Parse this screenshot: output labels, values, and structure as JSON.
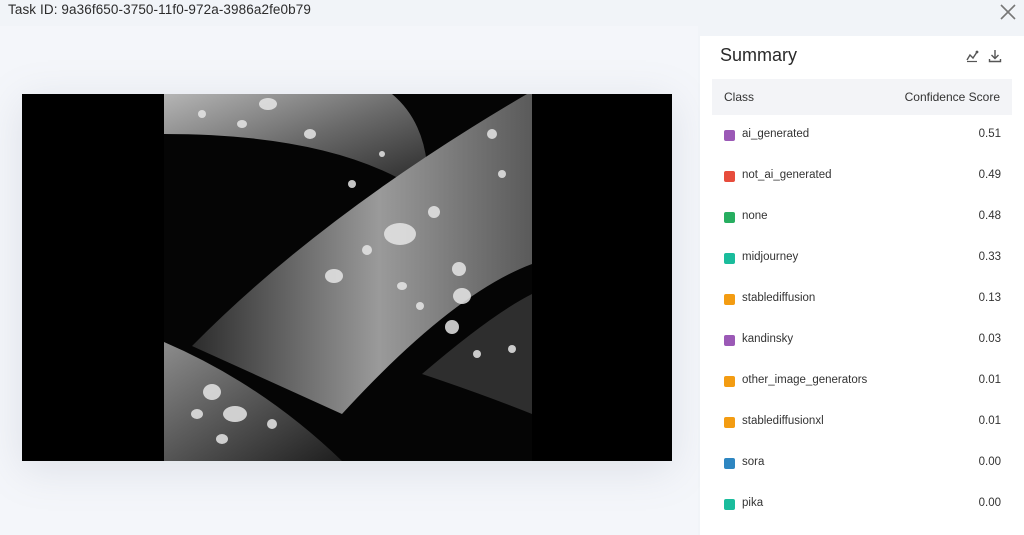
{
  "header": {
    "task_id_text": "Task ID: 9a36f650-3750-11f0-972a-3986a2fe0b79",
    "close_icon": "close-icon"
  },
  "image": {
    "icon": "image-preview",
    "colors": {
      "background": "#000000",
      "leaf": "#8a8a8a"
    }
  },
  "summary": {
    "title": "Summary",
    "icons": [
      "chart-icon",
      "download-icon"
    ],
    "columns": {
      "class": "Class",
      "score": "Confidence Score"
    },
    "rows": [
      {
        "label": "ai_generated",
        "score": "0.51",
        "color": "#9b59b6"
      },
      {
        "label": "not_ai_generated",
        "score": "0.49",
        "color": "#e74c3c"
      },
      {
        "label": "none",
        "score": "0.48",
        "color": "#27ae60"
      },
      {
        "label": "midjourney",
        "score": "0.33",
        "color": "#1abc9c"
      },
      {
        "label": "stablediffusion",
        "score": "0.13",
        "color": "#f39c12"
      },
      {
        "label": "kandinsky",
        "score": "0.03",
        "color": "#9b59b6"
      },
      {
        "label": "other_image_generators",
        "score": "0.01",
        "color": "#f39c12"
      },
      {
        "label": "stablediffusionxl",
        "score": "0.01",
        "color": "#f39c12"
      },
      {
        "label": "sora",
        "score": "0.00",
        "color": "#2e86c1"
      },
      {
        "label": "pika",
        "score": "0.00",
        "color": "#1abc9c"
      }
    ]
  }
}
